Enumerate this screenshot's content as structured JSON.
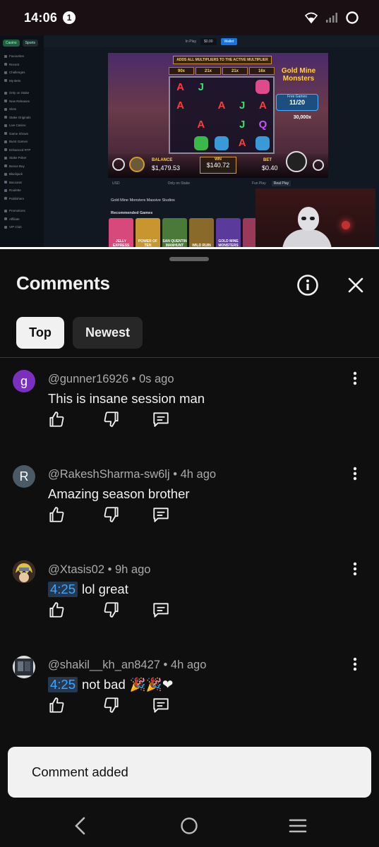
{
  "status_bar": {
    "time": "14:06",
    "notification_count": "1"
  },
  "video": {
    "casino": {
      "tabs": [
        "Casino",
        "Sports"
      ],
      "sidebar_items": [
        "Favourites",
        "Recent",
        "Challenges",
        "My Bets",
        "Only on Stake",
        "New Releases",
        "Slots",
        "Stake Originals",
        "Live Casino",
        "Game Shows",
        "Burst Games",
        "Enhanced RTP",
        "Stake Poker",
        "Bonus Buy",
        "Blackjack",
        "Baccarat",
        "Roulette",
        "Publishers",
        "Promotions",
        "Affiliate",
        "VIP Club"
      ],
      "top_mode": "In Play",
      "top_balance": "$0.00",
      "wallet_label": "Wallet",
      "game_name": "Gold Mine Monsters",
      "game_banner": "ADDS ALL MULTIPLIERS TO THE ACTIVE MULTIPLIER",
      "multipliers": [
        "90x",
        "21x",
        "21x",
        "16x"
      ],
      "free_games_label": "Free Games",
      "free_games_value": "11/20",
      "max_win": "30,000x",
      "balance_label": "BALANCE",
      "balance_value": "$1,479.53",
      "win_label": "WIN",
      "win_value": "$140.72",
      "bet_label": "BET",
      "bet_value": "$0.40",
      "currency": "USD",
      "only_on": "Only on Stake",
      "game_title_line": "Gold Mine Monsters  Massive Studios",
      "recommended_label": "Recommended Games",
      "recommended": [
        "JELLY EXPRESS",
        "POWER OF TEN",
        "SAN QUENTIN MANHUNT",
        "WILD RUIN",
        "GOLD MINE MONSTERS",
        ""
      ],
      "fun_play": "Fun Play",
      "real_play": "Real Play"
    },
    "progress": 1.0
  },
  "comments_panel": {
    "title": "Comments",
    "chips": [
      "Top",
      "Newest"
    ],
    "comments": [
      {
        "avatar_letter": "g",
        "avatar_color": "#7b2fbe",
        "author": "@gunner16926",
        "age": "0s ago",
        "timestamp": "",
        "text": "This is insane session man",
        "emoji": ""
      },
      {
        "avatar_letter": "R",
        "avatar_color": "#4a5a66",
        "author": "@RakeshSharma-sw6lj",
        "age": "4h ago",
        "timestamp": "",
        "text": "Amazing season brother",
        "emoji": ""
      },
      {
        "avatar_letter": "",
        "avatar_color": "#c7a64a",
        "author": "@Xtasis02",
        "age": "9h ago",
        "timestamp": "4:25",
        "text": "lol great",
        "emoji": ""
      },
      {
        "avatar_letter": "",
        "avatar_color": "#3a4048",
        "author": "@shakil__kh_an8427",
        "age": "4h ago",
        "timestamp": "4:25",
        "text": "not bad",
        "emoji": "🎉🎉❤"
      }
    ]
  },
  "toast": {
    "message": "Comment added"
  },
  "colors": {
    "background": "#0f0f0f",
    "timestamp_link": "#3ea6ff",
    "chip_active_bg": "#f1f1f1",
    "chip_inactive_bg": "#272727"
  }
}
